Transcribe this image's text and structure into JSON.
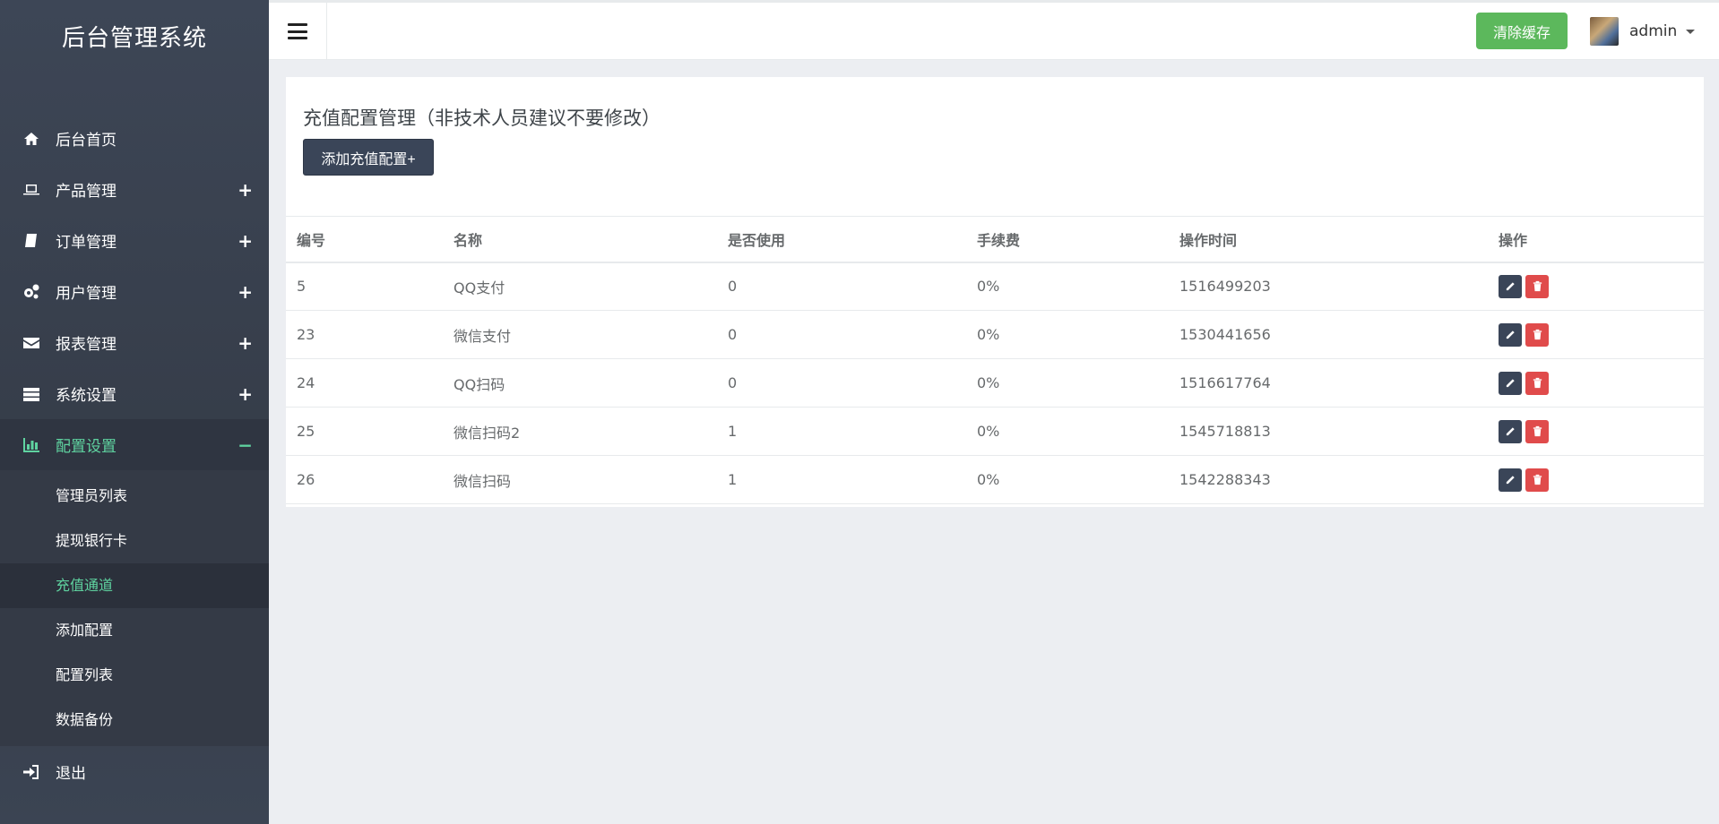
{
  "brand": "后台管理系统",
  "sidebar": {
    "items": [
      {
        "label": "后台首页",
        "icon": "home-icon",
        "toggle": ""
      },
      {
        "label": "产品管理",
        "icon": "laptop-icon",
        "toggle": "+"
      },
      {
        "label": "订单管理",
        "icon": "book-icon",
        "toggle": "+"
      },
      {
        "label": "用户管理",
        "icon": "gears-icon",
        "toggle": "+"
      },
      {
        "label": "报表管理",
        "icon": "envelope-icon",
        "toggle": "+"
      },
      {
        "label": "系统设置",
        "icon": "server-icon",
        "toggle": "+"
      },
      {
        "label": "配置设置",
        "icon": "bar-chart-icon",
        "toggle": "−"
      }
    ],
    "submenu": [
      {
        "label": "管理员列表"
      },
      {
        "label": "提现银行卡"
      },
      {
        "label": "充值通道"
      },
      {
        "label": "添加配置"
      },
      {
        "label": "配置列表"
      },
      {
        "label": "数据备份"
      }
    ],
    "logout": "退出"
  },
  "topbar": {
    "clear_cache": "清除缓存",
    "username": "admin"
  },
  "panel": {
    "title": "充值配置管理（非技术人员建议不要修改）",
    "add_button": "添加充值配置+"
  },
  "table": {
    "headers": [
      "编号",
      "名称",
      "是否使用",
      "手续费",
      "操作时间",
      "操作"
    ],
    "rows": [
      [
        "5",
        "QQ支付",
        "0",
        "0%",
        "1516499203"
      ],
      [
        "23",
        "微信支付",
        "0",
        "0%",
        "1530441656"
      ],
      [
        "24",
        "QQ扫码",
        "0",
        "0%",
        "1516617764"
      ],
      [
        "25",
        "微信扫码2",
        "1",
        "0%",
        "1545718813"
      ],
      [
        "26",
        "微信扫码",
        "1",
        "0%",
        "1542288343"
      ]
    ]
  },
  "colors": {
    "sidebar_bg": "#3d4656",
    "active_accent": "#5fd3a0",
    "clear_button": "#5cb85c",
    "edit_button": "#3a4558",
    "delete_button": "#e04b4b"
  }
}
